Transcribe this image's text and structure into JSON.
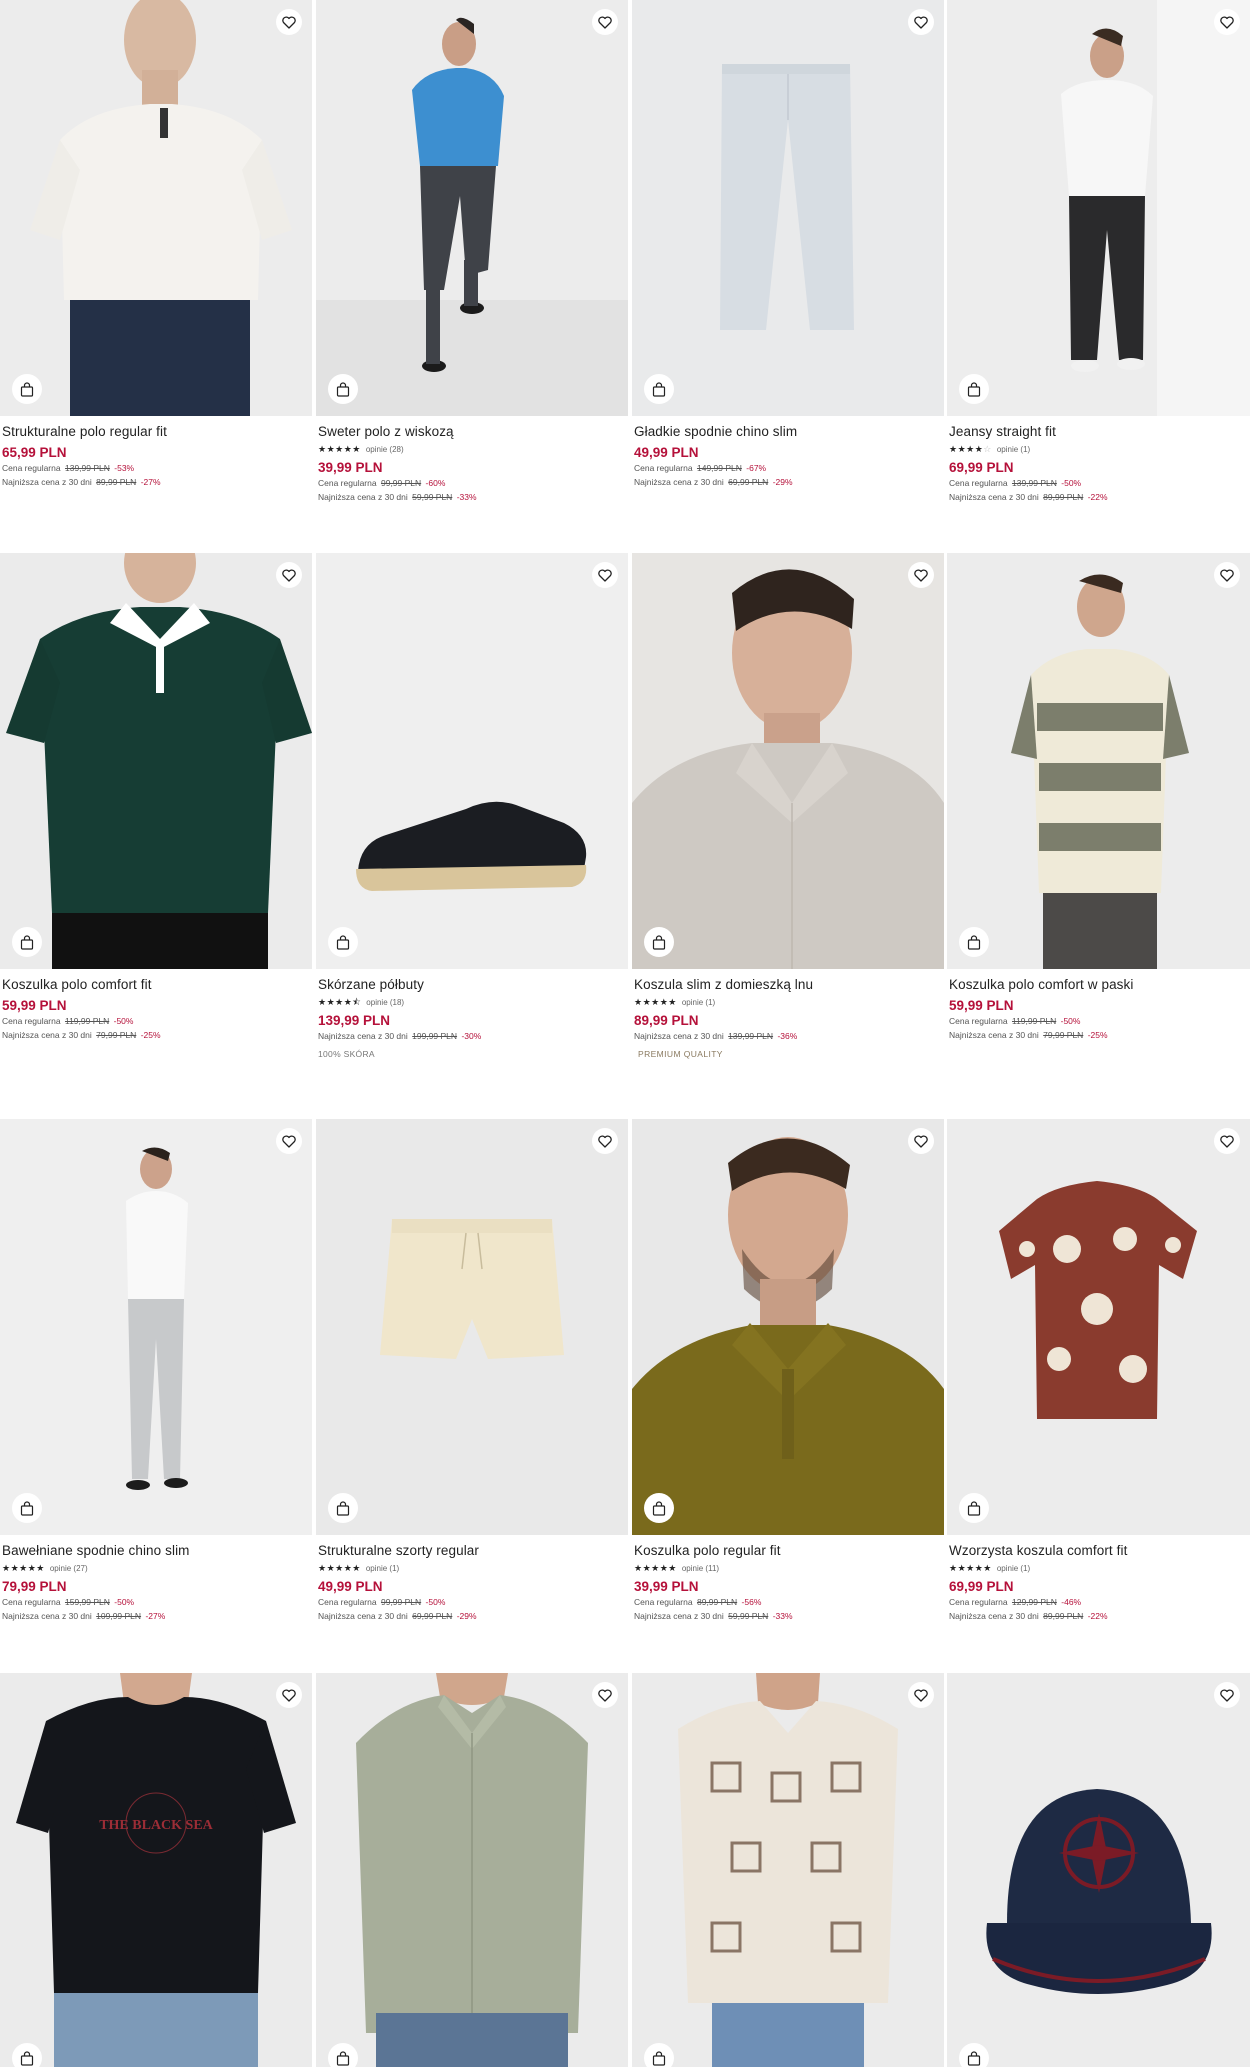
{
  "labels": {
    "regular": "Cena regularna",
    "lowest": "Najniższa cena z 30 dni"
  },
  "products": [
    {
      "name": "Strukturalne polo regular fit",
      "price": "65,99 PLN",
      "regular_price": "139,99 PLN",
      "regular_disc": "-53%",
      "lowest_price": "89,99 PLN",
      "lowest_disc": "-27%",
      "tag": "",
      "rating": 0,
      "reviews": ""
    },
    {
      "name": "Sweter polo z wiskozą",
      "price": "39,99 PLN",
      "regular_price": "99,99 PLN",
      "regular_disc": "-60%",
      "lowest_price": "59,99 PLN",
      "lowest_disc": "-33%",
      "tag": "",
      "rating": 5,
      "reviews": "opinie (28)"
    },
    {
      "name": "Gładkie spodnie chino slim",
      "price": "49,99 PLN",
      "regular_price": "149,99 PLN",
      "regular_disc": "-67%",
      "lowest_price": "69,99 PLN",
      "lowest_disc": "-29%",
      "tag": "",
      "rating": 0,
      "reviews": ""
    },
    {
      "name": "Jeansy straight fit",
      "price": "69,99 PLN",
      "regular_price": "139,99 PLN",
      "regular_disc": "-50%",
      "lowest_price": "89,99 PLN",
      "lowest_disc": "-22%",
      "tag": "",
      "rating": 4,
      "reviews": "opinie (1)"
    },
    {
      "name": "Koszulka polo comfort fit",
      "price": "59,99 PLN",
      "regular_price": "119,99 PLN",
      "regular_disc": "-50%",
      "lowest_price": "79,99 PLN",
      "lowest_disc": "-25%",
      "tag": "",
      "rating": 0,
      "reviews": ""
    },
    {
      "name": "Skórzane półbuty",
      "price": "139,99 PLN",
      "regular_price": "",
      "regular_disc": "",
      "lowest_price": "199,99 PLN",
      "lowest_disc": "-30%",
      "tag": "100% SKÓRA",
      "rating": 4.5,
      "reviews": "opinie (18)"
    },
    {
      "name": "Koszula slim z domieszką lnu",
      "price": "89,99 PLN",
      "regular_price": "",
      "regular_disc": "",
      "lowest_price": "139,99 PLN",
      "lowest_disc": "-36%",
      "tag": "PREMIUM QUALITY",
      "rating": 5,
      "reviews": "opinie (1)"
    },
    {
      "name": "Koszulka polo comfort w paski",
      "price": "59,99 PLN",
      "regular_price": "119,99 PLN",
      "regular_disc": "-50%",
      "lowest_price": "79,99 PLN",
      "lowest_disc": "-25%",
      "tag": "",
      "rating": 0,
      "reviews": ""
    },
    {
      "name": "Bawełniane spodnie chino slim",
      "price": "79,99 PLN",
      "regular_price": "159,99 PLN",
      "regular_disc": "-50%",
      "lowest_price": "109,99 PLN",
      "lowest_disc": "-27%",
      "tag": "",
      "rating": 5,
      "reviews": "opinie (27)"
    },
    {
      "name": "Strukturalne szorty regular",
      "price": "49,99 PLN",
      "regular_price": "99,99 PLN",
      "regular_disc": "-50%",
      "lowest_price": "69,99 PLN",
      "lowest_disc": "-29%",
      "tag": "",
      "rating": 5,
      "reviews": "opinie (1)"
    },
    {
      "name": "Koszulka polo regular fit",
      "price": "39,99 PLN",
      "regular_price": "89,99 PLN",
      "regular_disc": "-56%",
      "lowest_price": "59,99 PLN",
      "lowest_disc": "-33%",
      "tag": "",
      "rating": 5,
      "reviews": "opinie (11)"
    },
    {
      "name": "Wzorzysta koszula comfort fit",
      "price": "69,99 PLN",
      "regular_price": "129,99 PLN",
      "regular_disc": "-46%",
      "lowest_price": "89,99 PLN",
      "lowest_disc": "-22%",
      "tag": "",
      "rating": 5,
      "reviews": "opinie (1)"
    },
    {
      "name": "",
      "price": "",
      "regular_price": "",
      "regular_disc": "",
      "lowest_price": "",
      "lowest_disc": "",
      "tag": "",
      "rating": 0,
      "reviews": "",
      "print_text": "THE BLACK SEA"
    },
    {
      "name": "",
      "price": "",
      "regular_price": "",
      "regular_disc": "",
      "lowest_price": "",
      "lowest_disc": "",
      "tag": "",
      "rating": 0,
      "reviews": ""
    },
    {
      "name": "",
      "price": "",
      "regular_price": "",
      "regular_disc": "",
      "lowest_price": "",
      "lowest_disc": "",
      "tag": "",
      "rating": 0,
      "reviews": ""
    },
    {
      "name": "",
      "price": "",
      "regular_price": "",
      "regular_disc": "",
      "lowest_price": "",
      "lowest_disc": "",
      "tag": "",
      "rating": 0,
      "reviews": ""
    }
  ],
  "icons": {
    "favorite": "heart-icon",
    "cart": "shopping-bag-icon"
  },
  "colors": {
    "price": "#b5113a",
    "text": "#222222"
  }
}
